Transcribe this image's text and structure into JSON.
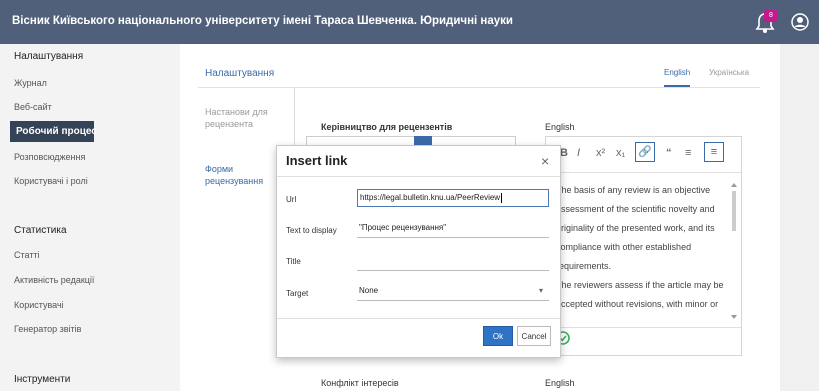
{
  "header": {
    "title": "Вісник Київського національного університету імені Тараса Шевченка. Юридичні науки",
    "notification_count": "8",
    "colors": {
      "bar": "#50607a",
      "badge": "#c51b8a"
    }
  },
  "sidebar": {
    "settings_heading": "Налаштування",
    "settings_items": [
      "Журнал",
      "Веб-сайт",
      "Робочий процес",
      "Розповсюдження",
      "Користувачі і ролі"
    ],
    "active_item": "Робочий процес",
    "stats_heading": "Статистика",
    "stats_items": [
      "Статті",
      "Активність редакції",
      "Користувачі",
      "Генератор звітів"
    ],
    "tools_heading": "Інструменти"
  },
  "panel": {
    "title": "Налаштування",
    "lang_tabs": [
      "English",
      "Українська"
    ],
    "vertical_tabs": [
      "Настанови для рецензента",
      "Форми рецензування"
    ],
    "guidelines_label": "Керівництво для рецензентів",
    "guidelines_lang": "English",
    "editor_text": "The basis of any review is an objective assessment of the scientific novelty and originality of the presented work, and its compliance with other established requirements.\nThe reviewers assess if the article may be accepted without revisions, with minor or",
    "competing_label": "Конфлікт інтересів",
    "competing_lang": "English"
  },
  "dialog": {
    "title": "Insert link",
    "url_label": "Url",
    "url_value": "https://legal.bulletin.knu.ua/PeerReview",
    "text_label": "Text to display",
    "text_value": "\"Процес рецензування\"",
    "title_label": "Title",
    "title_value": "",
    "target_label": "Target",
    "target_value": "None",
    "ok_label": "Ok",
    "cancel_label": "Cancel"
  }
}
